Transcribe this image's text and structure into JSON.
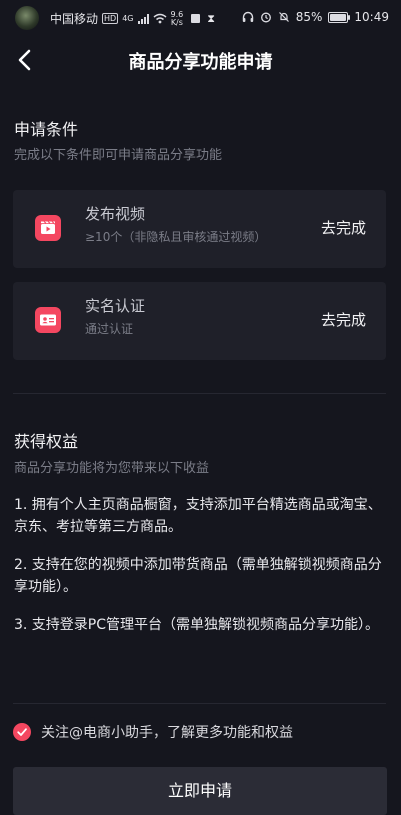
{
  "status_bar": {
    "carrier": "中国移动",
    "hd": "HD",
    "net_type": "4G",
    "speed_value": "9.6",
    "speed_unit": "K/s",
    "battery_percent": "85%",
    "time": "10:49"
  },
  "nav": {
    "title": "商品分享功能申请"
  },
  "conditions": {
    "heading": "申请条件",
    "subtitle": "完成以下条件即可申请商品分享功能",
    "items": [
      {
        "title": "发布视频",
        "subtitle": "≥10个（非隐私且审核通过视频）",
        "action": "去完成",
        "icon": "video-clapper-icon"
      },
      {
        "title": "实名认证",
        "subtitle": "通过认证",
        "action": "去完成",
        "icon": "id-card-icon"
      }
    ]
  },
  "benefits": {
    "heading": "获得权益",
    "subtitle": "商品分享功能将为您带来以下收益",
    "items": [
      "1. 拥有个人主页商品橱窗，支持添加平台精选商品或淘宝、京东、考拉等第三方商品。",
      "2. 支持在您的视频中添加带货商品（需单独解锁视频商品分享功能）。",
      "3. 支持登录PC管理平台（需单独解锁视频商品分享功能）。"
    ]
  },
  "agreement": {
    "label": "关注@电商小助手，了解更多功能和权益",
    "checked": true
  },
  "apply_button": {
    "label": "立即申请"
  },
  "colors": {
    "background": "#15161e",
    "card": "#1f2029",
    "accent": "#f44760",
    "button": "#2b2c36"
  }
}
